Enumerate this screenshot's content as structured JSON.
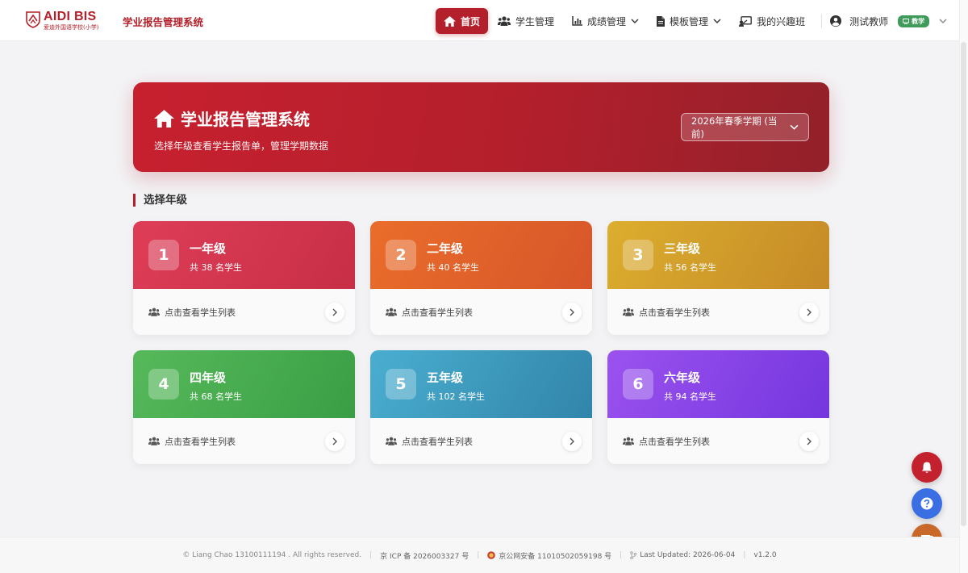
{
  "header": {
    "logo_main": "AIDI BIS",
    "logo_sub": "爱迪外国语学校(小学)",
    "system_title": "学业报告管理系统",
    "nav": [
      {
        "label": "首页",
        "icon": "home-icon",
        "active": true
      },
      {
        "label": "学生管理",
        "icon": "users-icon"
      },
      {
        "label": "成绩管理",
        "icon": "chart-icon",
        "dropdown": true
      },
      {
        "label": "模板管理",
        "icon": "file-icon",
        "dropdown": true
      },
      {
        "label": "我的兴趣班",
        "icon": "teacher-icon"
      }
    ],
    "user_name": "测试教师",
    "user_badge": "教学"
  },
  "hero": {
    "title": "学业报告管理系统",
    "subtitle": "选择年级查看学生报告单，管理学期数据",
    "term_selected": "2026年春季学期 (当前)"
  },
  "section": {
    "title": "选择年级"
  },
  "grades": [
    {
      "num": "1",
      "name": "一年级",
      "count": "共 38 名学生",
      "action": "点击查看学生列表"
    },
    {
      "num": "2",
      "name": "二年级",
      "count": "共 40 名学生",
      "action": "点击查看学生列表"
    },
    {
      "num": "3",
      "name": "三年级",
      "count": "共 56 名学生",
      "action": "点击查看学生列表"
    },
    {
      "num": "4",
      "name": "四年级",
      "count": "共 68 名学生",
      "action": "点击查看学生列表"
    },
    {
      "num": "5",
      "name": "五年级",
      "count": "共 102 名学生",
      "action": "点击查看学生列表"
    },
    {
      "num": "6",
      "name": "六年级",
      "count": "共 94 名学生",
      "action": "点击查看学生列表"
    }
  ],
  "footer": {
    "copyright": "© Liang Chao 13100111194 . All rights reserved.",
    "icp": "京 ICP 备 2026003327 号",
    "police": "京公网安备 11010502059198 号",
    "updated": "Last Updated: 2026-06-04",
    "version": "v1.2.0"
  },
  "colors": {
    "brand": "#b3202b",
    "grade1": "#d9364e",
    "grade2": "#e2662b",
    "grade3": "#cf9a2a",
    "grade4": "#4aac4e",
    "grade5": "#3c9dbc",
    "grade6": "#8445e8"
  }
}
